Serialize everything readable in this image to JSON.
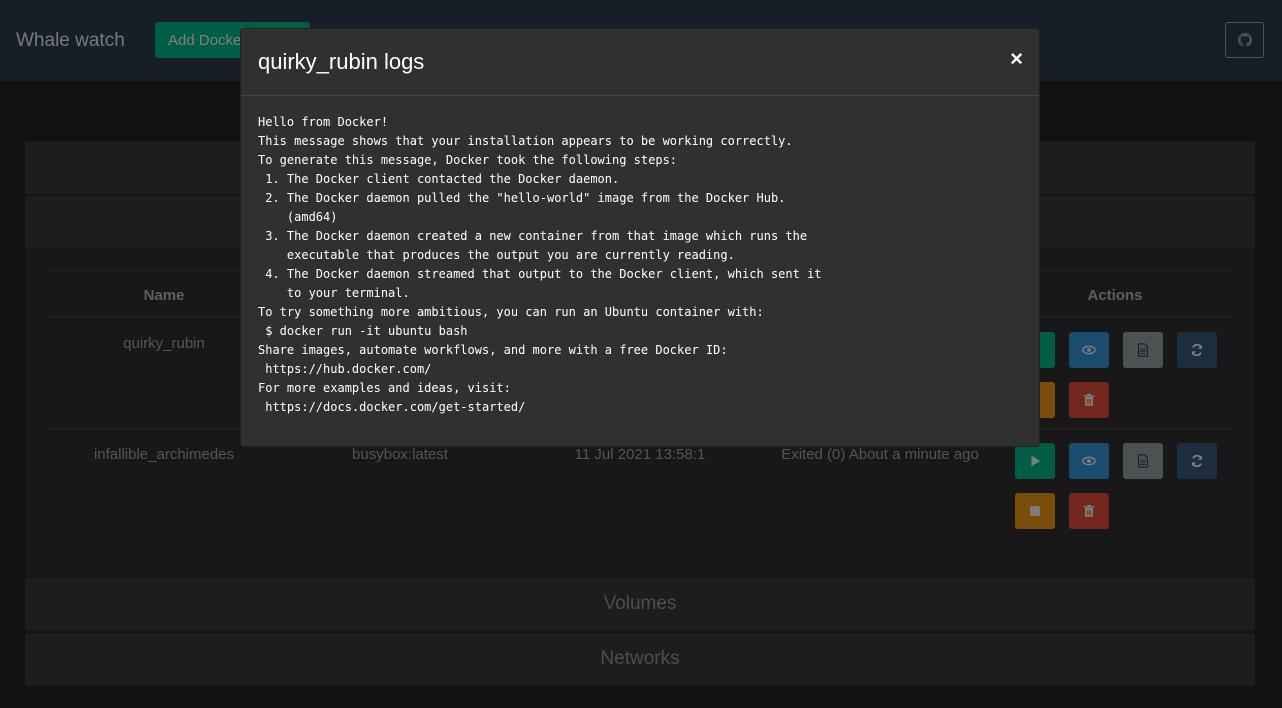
{
  "navbar": {
    "brand": "Whale watch",
    "add_button": "Add Docker host",
    "github_icon": "github-icon"
  },
  "sections": {
    "volumes": "Volumes",
    "networks": "Networks"
  },
  "table": {
    "headers": {
      "name": "Name",
      "actions": "Actions"
    },
    "rows": [
      {
        "name": "quirky_rubin",
        "image": "",
        "created": "",
        "status": ""
      },
      {
        "name": "infallible_archimedes",
        "image": "busybox:latest",
        "created": "11 Jul 2021 13:58:1",
        "status": "Exited (0) About a minute ago"
      }
    ]
  },
  "colors": {
    "navbar": "#2c3e50",
    "success": "#00bc8c",
    "info": "#3498db",
    "secondary": "#95a5a6",
    "primary": "#375a7f",
    "warning": "#f39c12",
    "danger": "#e74c3c"
  },
  "modal": {
    "title": "quirky_rubin logs",
    "close": "×",
    "log_lines": [
      "Hello from Docker!",
      "This message shows that your installation appears to be working correctly.",
      "To generate this message, Docker took the following steps:",
      " 1. The Docker client contacted the Docker daemon.",
      " 2. The Docker daemon pulled the \"hello-world\" image from the Docker Hub.",
      "    (amd64)",
      " 3. The Docker daemon created a new container from that image which runs the",
      "    executable that produces the output you are currently reading.",
      " 4. The Docker daemon streamed that output to the Docker client, which sent it",
      "    to your terminal.",
      "To try something more ambitious, you can run an Ubuntu container with:",
      " $ docker run -it ubuntu bash",
      "Share images, automate workflows, and more with a free Docker ID:",
      " https://hub.docker.com/",
      "For more examples and ideas, visit:",
      " https://docs.docker.com/get-started/"
    ]
  }
}
